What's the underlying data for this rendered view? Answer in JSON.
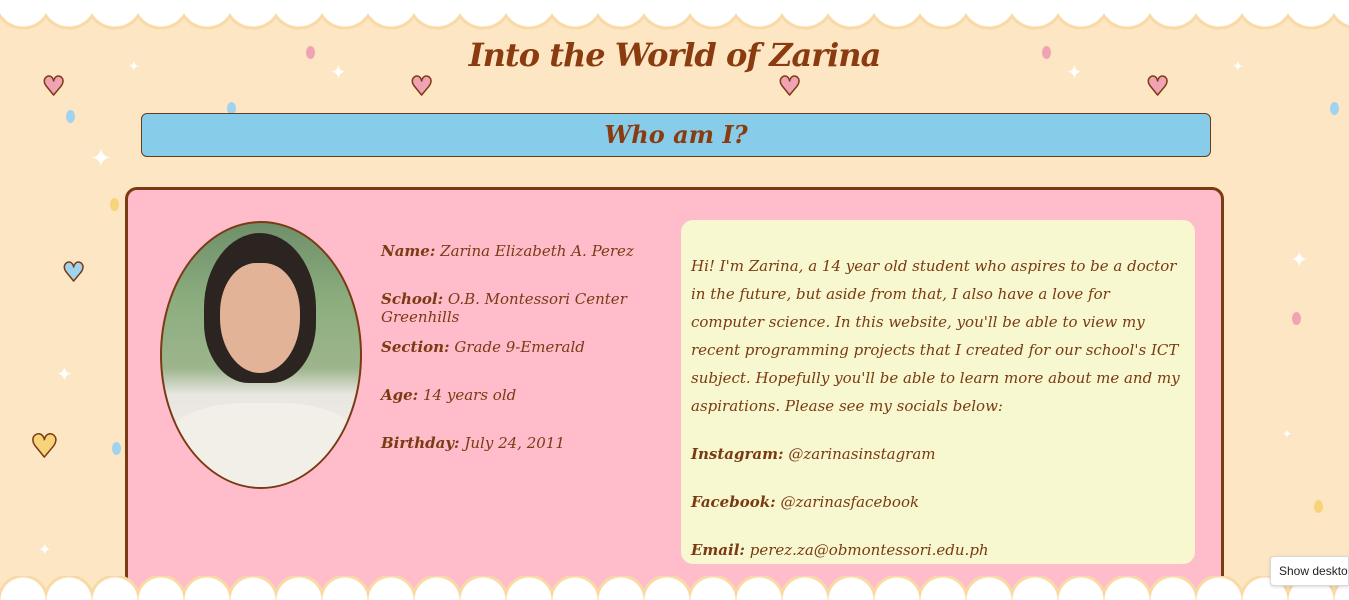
{
  "page": {
    "title": "Into the World of Zarina",
    "section_heading": "Who am I?"
  },
  "profile": {
    "photo_alt": "Portrait photo",
    "fields": [
      {
        "label": "Name:",
        "value": "Zarina Elizabeth A. Perez"
      },
      {
        "label": "School:",
        "value": "O.B. Montessori Center Greenhills"
      },
      {
        "label": "Section:",
        "value": "Grade 9-Emerald"
      },
      {
        "label": "Age:",
        "value": "14 years old"
      },
      {
        "label": "Birthday:",
        "value": "July 24, 2011"
      }
    ]
  },
  "bio": {
    "intro": "Hi! I'm Zarina, a 14 year old student who aspires to be a doctor in the future, but aside from that, I also have a love for computer science. In this website, you'll be able to view my recent programming projects that I created for our school's ICT subject. Hopefully you'll be able to learn more about me and my aspirations. Please see my socials below:",
    "socials": [
      {
        "label": "Instagram:",
        "value": "@zarinasinstagram"
      },
      {
        "label": "Facebook:",
        "value": "@zarinasfacebook"
      },
      {
        "label": "Email:",
        "value": "perez.za@obmontessori.edu.ph"
      }
    ]
  },
  "overlay": {
    "show_desktop_label": "Show desktop"
  },
  "colors": {
    "background": "#fde6c3",
    "heading_text": "#8a3b10",
    "who_bar": "#87cde9",
    "card": "#ffbccb",
    "bio_panel": "#f7f7d0",
    "border": "#7a3a12"
  },
  "icons": {
    "heart": "heart-icon",
    "sparkle": "sparkle-icon"
  }
}
